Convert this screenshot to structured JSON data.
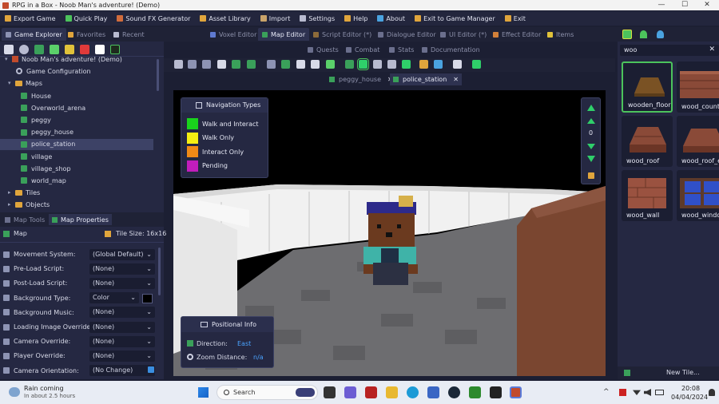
{
  "window": {
    "title": "RPG in a Box - Noob Man's adventure! (Demo)",
    "minimize": "—",
    "maximize": "☐",
    "close": "✕"
  },
  "menu": [
    {
      "label": "Export Game",
      "color": "#e0a53c"
    },
    {
      "label": "Quick Play",
      "color": "#4cc35c"
    },
    {
      "label": "Sound FX Generator",
      "color": "#d26c3c"
    },
    {
      "label": "Asset Library",
      "color": "#e0a53c"
    },
    {
      "label": "Import",
      "color": "#c9a36a"
    },
    {
      "label": "Settings",
      "color": "#b8bbd0"
    },
    {
      "label": "Help",
      "color": "#e0a53c"
    },
    {
      "label": "About",
      "color": "#4aa3e0"
    },
    {
      "label": "Exit to Game Manager",
      "color": "#e0a53c"
    },
    {
      "label": "Exit",
      "color": "#e0a53c"
    }
  ],
  "left_tabs": [
    {
      "label": "Game Explorer"
    },
    {
      "label": "Favorites"
    },
    {
      "label": "Recent"
    }
  ],
  "editor_tabs": [
    {
      "label": "Voxel Editor"
    },
    {
      "label": "Map Editor"
    },
    {
      "label": "Script Editor (*)"
    },
    {
      "label": "Dialogue Editor"
    },
    {
      "label": "UI Editor (*)"
    },
    {
      "label": "Effect Editor"
    },
    {
      "label": "Items"
    }
  ],
  "editor_tabs2": [
    {
      "label": "Quests"
    },
    {
      "label": "Combat"
    },
    {
      "label": "Stats"
    },
    {
      "label": "Documentation"
    }
  ],
  "tree": {
    "root": "Noob Man's adventure! (Demo)",
    "config": "Game Configuration",
    "maps_folder": "Maps",
    "maps": [
      "House",
      "Overworld_arena",
      "peggy",
      "peggy_house",
      "police_station",
      "village",
      "village_shop",
      "world_map"
    ],
    "selected": "police_station",
    "tiles_folder": "Tiles",
    "objects_folder": "Objects"
  },
  "lower_tabs": {
    "map_tools": "Map Tools",
    "map_properties": "Map Properties"
  },
  "props_header": {
    "label": "Map",
    "tile_size": "Tile Size: 16x16"
  },
  "properties": [
    {
      "label": "Movement System:",
      "value": "(Global Default)"
    },
    {
      "label": "Pre-Load Script:",
      "value": "(None)"
    },
    {
      "label": "Post-Load Script:",
      "value": "(None)"
    },
    {
      "label": "Background Type:",
      "value": "Color"
    },
    {
      "label": "Background Music:",
      "value": "(None)"
    },
    {
      "label": "Loading Image Override:",
      "value": "(None)"
    },
    {
      "label": "Camera Override:",
      "value": "(None)"
    },
    {
      "label": "Player Override:",
      "value": "(None)"
    },
    {
      "label": "Camera Orientation:",
      "value": "(No Change)"
    }
  ],
  "map_tabs": [
    {
      "label": "peggy_house",
      "close": "✕"
    },
    {
      "label": "police_station",
      "close": "✕"
    }
  ],
  "nav_types": {
    "title": "Navigation Types",
    "items": [
      {
        "label": "Walk and Interact",
        "color": "#19d21c"
      },
      {
        "label": "Walk Only",
        "color": "#f5ef12"
      },
      {
        "label": "Interact Only",
        "color": "#f08a16"
      },
      {
        "label": "Pending",
        "color": "#c21dbc"
      }
    ]
  },
  "camera": {
    "level": "0"
  },
  "positional": {
    "title": "Positional Info",
    "direction_label": "Direction:",
    "direction_value": "East",
    "zoom_label": "Zoom Distance:",
    "zoom_value": "n/a"
  },
  "search": {
    "value": "woo",
    "clear": "✕"
  },
  "tiles": [
    {
      "label": "wooden_floor"
    },
    {
      "label": "wood_count"
    },
    {
      "label": "wood_roof"
    },
    {
      "label": "wood_roof_e"
    },
    {
      "label": "wood_wall"
    },
    {
      "label": "wood_windo"
    }
  ],
  "new_tile": "New Tile...",
  "taskbar": {
    "weather_title": "Rain coming",
    "weather_sub": "In about 2.5 hours",
    "search_placeholder": "Search",
    "time": "20:08",
    "date": "04/04/2024"
  }
}
